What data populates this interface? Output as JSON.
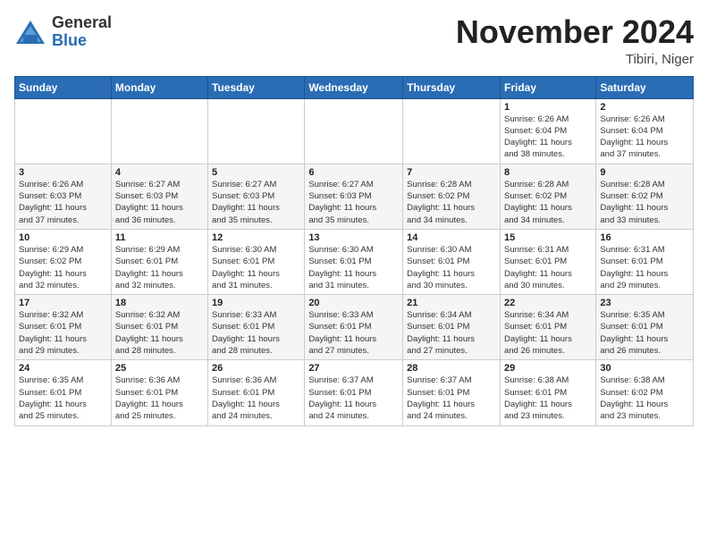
{
  "header": {
    "logo_general": "General",
    "logo_blue": "Blue",
    "month_title": "November 2024",
    "location": "Tibiri, Niger"
  },
  "days_of_week": [
    "Sunday",
    "Monday",
    "Tuesday",
    "Wednesday",
    "Thursday",
    "Friday",
    "Saturday"
  ],
  "weeks": [
    [
      {
        "day": "",
        "info": ""
      },
      {
        "day": "",
        "info": ""
      },
      {
        "day": "",
        "info": ""
      },
      {
        "day": "",
        "info": ""
      },
      {
        "day": "",
        "info": ""
      },
      {
        "day": "1",
        "info": "Sunrise: 6:26 AM\nSunset: 6:04 PM\nDaylight: 11 hours\nand 38 minutes."
      },
      {
        "day": "2",
        "info": "Sunrise: 6:26 AM\nSunset: 6:04 PM\nDaylight: 11 hours\nand 37 minutes."
      }
    ],
    [
      {
        "day": "3",
        "info": "Sunrise: 6:26 AM\nSunset: 6:03 PM\nDaylight: 11 hours\nand 37 minutes."
      },
      {
        "day": "4",
        "info": "Sunrise: 6:27 AM\nSunset: 6:03 PM\nDaylight: 11 hours\nand 36 minutes."
      },
      {
        "day": "5",
        "info": "Sunrise: 6:27 AM\nSunset: 6:03 PM\nDaylight: 11 hours\nand 35 minutes."
      },
      {
        "day": "6",
        "info": "Sunrise: 6:27 AM\nSunset: 6:03 PM\nDaylight: 11 hours\nand 35 minutes."
      },
      {
        "day": "7",
        "info": "Sunrise: 6:28 AM\nSunset: 6:02 PM\nDaylight: 11 hours\nand 34 minutes."
      },
      {
        "day": "8",
        "info": "Sunrise: 6:28 AM\nSunset: 6:02 PM\nDaylight: 11 hours\nand 34 minutes."
      },
      {
        "day": "9",
        "info": "Sunrise: 6:28 AM\nSunset: 6:02 PM\nDaylight: 11 hours\nand 33 minutes."
      }
    ],
    [
      {
        "day": "10",
        "info": "Sunrise: 6:29 AM\nSunset: 6:02 PM\nDaylight: 11 hours\nand 32 minutes."
      },
      {
        "day": "11",
        "info": "Sunrise: 6:29 AM\nSunset: 6:01 PM\nDaylight: 11 hours\nand 32 minutes."
      },
      {
        "day": "12",
        "info": "Sunrise: 6:30 AM\nSunset: 6:01 PM\nDaylight: 11 hours\nand 31 minutes."
      },
      {
        "day": "13",
        "info": "Sunrise: 6:30 AM\nSunset: 6:01 PM\nDaylight: 11 hours\nand 31 minutes."
      },
      {
        "day": "14",
        "info": "Sunrise: 6:30 AM\nSunset: 6:01 PM\nDaylight: 11 hours\nand 30 minutes."
      },
      {
        "day": "15",
        "info": "Sunrise: 6:31 AM\nSunset: 6:01 PM\nDaylight: 11 hours\nand 30 minutes."
      },
      {
        "day": "16",
        "info": "Sunrise: 6:31 AM\nSunset: 6:01 PM\nDaylight: 11 hours\nand 29 minutes."
      }
    ],
    [
      {
        "day": "17",
        "info": "Sunrise: 6:32 AM\nSunset: 6:01 PM\nDaylight: 11 hours\nand 29 minutes."
      },
      {
        "day": "18",
        "info": "Sunrise: 6:32 AM\nSunset: 6:01 PM\nDaylight: 11 hours\nand 28 minutes."
      },
      {
        "day": "19",
        "info": "Sunrise: 6:33 AM\nSunset: 6:01 PM\nDaylight: 11 hours\nand 28 minutes."
      },
      {
        "day": "20",
        "info": "Sunrise: 6:33 AM\nSunset: 6:01 PM\nDaylight: 11 hours\nand 27 minutes."
      },
      {
        "day": "21",
        "info": "Sunrise: 6:34 AM\nSunset: 6:01 PM\nDaylight: 11 hours\nand 27 minutes."
      },
      {
        "day": "22",
        "info": "Sunrise: 6:34 AM\nSunset: 6:01 PM\nDaylight: 11 hours\nand 26 minutes."
      },
      {
        "day": "23",
        "info": "Sunrise: 6:35 AM\nSunset: 6:01 PM\nDaylight: 11 hours\nand 26 minutes."
      }
    ],
    [
      {
        "day": "24",
        "info": "Sunrise: 6:35 AM\nSunset: 6:01 PM\nDaylight: 11 hours\nand 25 minutes."
      },
      {
        "day": "25",
        "info": "Sunrise: 6:36 AM\nSunset: 6:01 PM\nDaylight: 11 hours\nand 25 minutes."
      },
      {
        "day": "26",
        "info": "Sunrise: 6:36 AM\nSunset: 6:01 PM\nDaylight: 11 hours\nand 24 minutes."
      },
      {
        "day": "27",
        "info": "Sunrise: 6:37 AM\nSunset: 6:01 PM\nDaylight: 11 hours\nand 24 minutes."
      },
      {
        "day": "28",
        "info": "Sunrise: 6:37 AM\nSunset: 6:01 PM\nDaylight: 11 hours\nand 24 minutes."
      },
      {
        "day": "29",
        "info": "Sunrise: 6:38 AM\nSunset: 6:01 PM\nDaylight: 11 hours\nand 23 minutes."
      },
      {
        "day": "30",
        "info": "Sunrise: 6:38 AM\nSunset: 6:02 PM\nDaylight: 11 hours\nand 23 minutes."
      }
    ]
  ]
}
